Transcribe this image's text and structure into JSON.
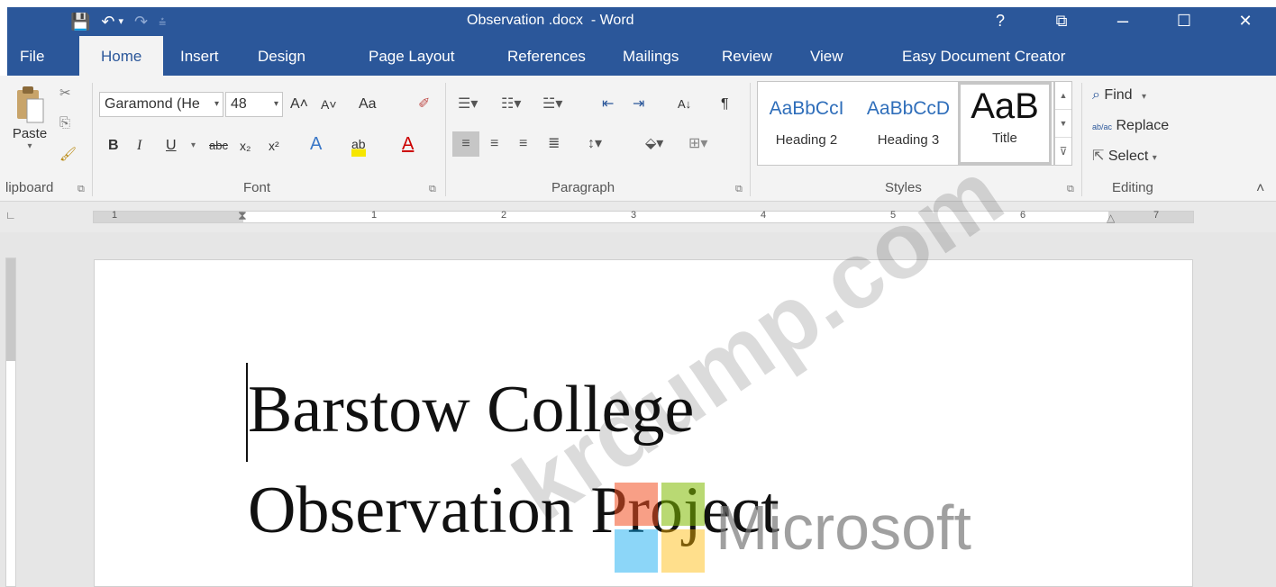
{
  "window": {
    "title": "Observation .docx  - Word",
    "help": "?",
    "restore_ribbon": "⧉",
    "minimize": "–",
    "maximize": "☐",
    "close": "✕"
  },
  "qat": {
    "save_icon": "💾",
    "undo_icon": "↶",
    "undo_dropdown": "▾",
    "redo_icon": "↷",
    "customize_icon": "⩮"
  },
  "tabs": [
    {
      "label": "File"
    },
    {
      "label": "Home"
    },
    {
      "label": "Insert"
    },
    {
      "label": "Design"
    },
    {
      "label": "Page Layout"
    },
    {
      "label": "References"
    },
    {
      "label": "Mailings"
    },
    {
      "label": "Review"
    },
    {
      "label": "View"
    },
    {
      "label": "Easy Document Creator"
    }
  ],
  "clipboard": {
    "paste_label": "Paste",
    "group_label": "lipboard",
    "paste_dropdown": "▾"
  },
  "font": {
    "family": "Garamond (He",
    "size": "48",
    "bold": "B",
    "italic": "I",
    "underline": "U",
    "strike": "abc",
    "subscript": "x₂",
    "superscript": "x²",
    "grow": "A˄",
    "shrink": "A˅",
    "case": "Aa",
    "effects": "A",
    "highlight": "ab",
    "color": "A",
    "group_label": "Font",
    "dropdown": "▾"
  },
  "paragraph": {
    "group_label": "Paragraph",
    "sort": "A↓",
    "pilcrow": "¶"
  },
  "styles": {
    "items": [
      {
        "sample": "AaBbCcI",
        "name": "Heading 2"
      },
      {
        "sample": "AaBbCcD",
        "name": "Heading 3"
      },
      {
        "sample": "AaB",
        "name": "Title"
      }
    ],
    "group_label": "Styles",
    "scroll_up": "▲",
    "scroll_down": "▼",
    "more": "⊽"
  },
  "editing": {
    "find": "Find",
    "replace": "Replace",
    "select": "Select",
    "group_label": "Editing",
    "find_icon": "⌕",
    "replace_icon": "ab/ac",
    "select_icon": "⇱",
    "dropdown": "▾"
  },
  "ribbon_collapse": "˄",
  "ruler": {
    "numbers": [
      "1",
      "1",
      "2",
      "3",
      "4",
      "5",
      "6",
      "7"
    ]
  },
  "document": {
    "line1": "Barstow College",
    "line2": "Observation Project"
  },
  "watermarks": {
    "site": "krdump.com",
    "brand": "Microsoft"
  },
  "colors": {
    "word_blue": "#2b579a",
    "ms_red": "#f25022",
    "ms_green": "#7fba00",
    "ms_blue": "#00a4ef",
    "ms_yellow": "#ffb900"
  }
}
